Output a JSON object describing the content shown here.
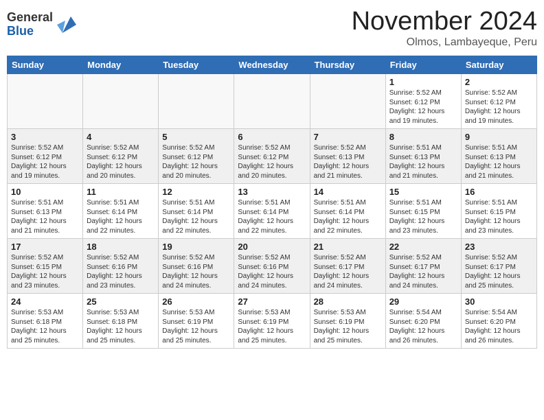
{
  "header": {
    "logo_general": "General",
    "logo_blue": "Blue",
    "month_year": "November 2024",
    "location": "Olmos, Lambayeque, Peru"
  },
  "weekdays": [
    "Sunday",
    "Monday",
    "Tuesday",
    "Wednesday",
    "Thursday",
    "Friday",
    "Saturday"
  ],
  "weeks": [
    [
      {
        "day": "",
        "info": ""
      },
      {
        "day": "",
        "info": ""
      },
      {
        "day": "",
        "info": ""
      },
      {
        "day": "",
        "info": ""
      },
      {
        "day": "",
        "info": ""
      },
      {
        "day": "1",
        "info": "Sunrise: 5:52 AM\nSunset: 6:12 PM\nDaylight: 12 hours\nand 19 minutes."
      },
      {
        "day": "2",
        "info": "Sunrise: 5:52 AM\nSunset: 6:12 PM\nDaylight: 12 hours\nand 19 minutes."
      }
    ],
    [
      {
        "day": "3",
        "info": "Sunrise: 5:52 AM\nSunset: 6:12 PM\nDaylight: 12 hours\nand 19 minutes."
      },
      {
        "day": "4",
        "info": "Sunrise: 5:52 AM\nSunset: 6:12 PM\nDaylight: 12 hours\nand 20 minutes."
      },
      {
        "day": "5",
        "info": "Sunrise: 5:52 AM\nSunset: 6:12 PM\nDaylight: 12 hours\nand 20 minutes."
      },
      {
        "day": "6",
        "info": "Sunrise: 5:52 AM\nSunset: 6:12 PM\nDaylight: 12 hours\nand 20 minutes."
      },
      {
        "day": "7",
        "info": "Sunrise: 5:52 AM\nSunset: 6:13 PM\nDaylight: 12 hours\nand 21 minutes."
      },
      {
        "day": "8",
        "info": "Sunrise: 5:51 AM\nSunset: 6:13 PM\nDaylight: 12 hours\nand 21 minutes."
      },
      {
        "day": "9",
        "info": "Sunrise: 5:51 AM\nSunset: 6:13 PM\nDaylight: 12 hours\nand 21 minutes."
      }
    ],
    [
      {
        "day": "10",
        "info": "Sunrise: 5:51 AM\nSunset: 6:13 PM\nDaylight: 12 hours\nand 21 minutes."
      },
      {
        "day": "11",
        "info": "Sunrise: 5:51 AM\nSunset: 6:14 PM\nDaylight: 12 hours\nand 22 minutes."
      },
      {
        "day": "12",
        "info": "Sunrise: 5:51 AM\nSunset: 6:14 PM\nDaylight: 12 hours\nand 22 minutes."
      },
      {
        "day": "13",
        "info": "Sunrise: 5:51 AM\nSunset: 6:14 PM\nDaylight: 12 hours\nand 22 minutes."
      },
      {
        "day": "14",
        "info": "Sunrise: 5:51 AM\nSunset: 6:14 PM\nDaylight: 12 hours\nand 22 minutes."
      },
      {
        "day": "15",
        "info": "Sunrise: 5:51 AM\nSunset: 6:15 PM\nDaylight: 12 hours\nand 23 minutes."
      },
      {
        "day": "16",
        "info": "Sunrise: 5:51 AM\nSunset: 6:15 PM\nDaylight: 12 hours\nand 23 minutes."
      }
    ],
    [
      {
        "day": "17",
        "info": "Sunrise: 5:52 AM\nSunset: 6:15 PM\nDaylight: 12 hours\nand 23 minutes."
      },
      {
        "day": "18",
        "info": "Sunrise: 5:52 AM\nSunset: 6:16 PM\nDaylight: 12 hours\nand 23 minutes."
      },
      {
        "day": "19",
        "info": "Sunrise: 5:52 AM\nSunset: 6:16 PM\nDaylight: 12 hours\nand 24 minutes."
      },
      {
        "day": "20",
        "info": "Sunrise: 5:52 AM\nSunset: 6:16 PM\nDaylight: 12 hours\nand 24 minutes."
      },
      {
        "day": "21",
        "info": "Sunrise: 5:52 AM\nSunset: 6:17 PM\nDaylight: 12 hours\nand 24 minutes."
      },
      {
        "day": "22",
        "info": "Sunrise: 5:52 AM\nSunset: 6:17 PM\nDaylight: 12 hours\nand 24 minutes."
      },
      {
        "day": "23",
        "info": "Sunrise: 5:52 AM\nSunset: 6:17 PM\nDaylight: 12 hours\nand 25 minutes."
      }
    ],
    [
      {
        "day": "24",
        "info": "Sunrise: 5:53 AM\nSunset: 6:18 PM\nDaylight: 12 hours\nand 25 minutes."
      },
      {
        "day": "25",
        "info": "Sunrise: 5:53 AM\nSunset: 6:18 PM\nDaylight: 12 hours\nand 25 minutes."
      },
      {
        "day": "26",
        "info": "Sunrise: 5:53 AM\nSunset: 6:19 PM\nDaylight: 12 hours\nand 25 minutes."
      },
      {
        "day": "27",
        "info": "Sunrise: 5:53 AM\nSunset: 6:19 PM\nDaylight: 12 hours\nand 25 minutes."
      },
      {
        "day": "28",
        "info": "Sunrise: 5:53 AM\nSunset: 6:19 PM\nDaylight: 12 hours\nand 25 minutes."
      },
      {
        "day": "29",
        "info": "Sunrise: 5:54 AM\nSunset: 6:20 PM\nDaylight: 12 hours\nand 26 minutes."
      },
      {
        "day": "30",
        "info": "Sunrise: 5:54 AM\nSunset: 6:20 PM\nDaylight: 12 hours\nand 26 minutes."
      }
    ]
  ]
}
